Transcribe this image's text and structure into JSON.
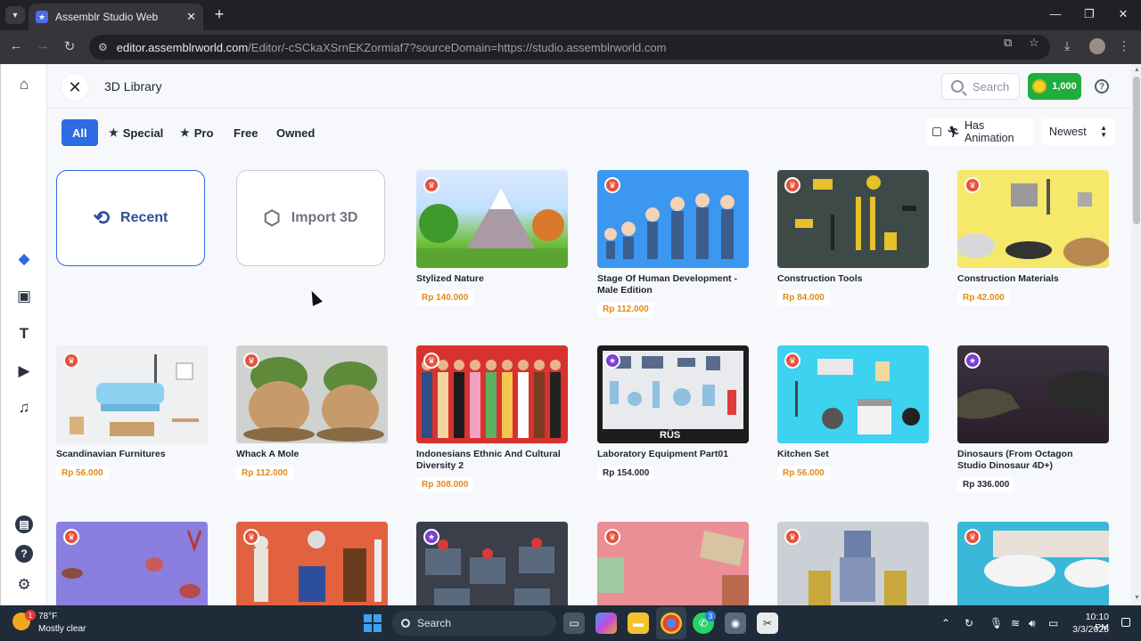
{
  "browser": {
    "tab_title": "Assemblr Studio Web",
    "url_host": "editor.assemblrworld.com",
    "url_rest": "/Editor/-cSCkaXSrnEKZormiaf7?sourceDomain=https://studio.assemblrworld.com"
  },
  "header": {
    "title": "3D Library",
    "search_label": "Search",
    "coins": "1,000"
  },
  "filters": {
    "tabs": [
      {
        "label": "All"
      },
      {
        "label": "Special"
      },
      {
        "label": "Pro"
      },
      {
        "label": "Free"
      },
      {
        "label": "Owned"
      }
    ],
    "has_animation_label": "Has Animation",
    "sort_value": "Newest"
  },
  "actions": {
    "recent_label": "Recent",
    "import_label": "Import 3D"
  },
  "items": [
    {
      "name": "Stylized Nature",
      "price": "Rp 140.000",
      "tier": "pro"
    },
    {
      "name": "Stage Of Human Development - Male Edition",
      "price": "Rp 112.000",
      "tier": "pro"
    },
    {
      "name": "Construction Tools",
      "price": "Rp 84.000",
      "tier": "pro"
    },
    {
      "name": "Construction Materials",
      "price": "Rp 42.000",
      "tier": "pro"
    },
    {
      "name": "Scandinavian Furnitures",
      "price": "Rp 56.000",
      "tier": "pro"
    },
    {
      "name": "Whack A Mole",
      "price": "Rp 112.000",
      "tier": "pro"
    },
    {
      "name": "Indonesians Ethnic And Cultural Diversity 2",
      "price": "Rp 308.000",
      "tier": "pro"
    },
    {
      "name": "Laboratory Equipment Part01",
      "price": "Rp 154.000",
      "tier": "special",
      "thumb_text": "RÜS"
    },
    {
      "name": "Kitchen Set",
      "price": "Rp 56.000",
      "tier": "pro"
    },
    {
      "name": "Dinosaurs (From Octagon Studio Dinosaur 4D+)",
      "price": "Rp 336.000",
      "tier": "special"
    },
    {
      "name": "",
      "price": "",
      "tier": "pro"
    },
    {
      "name": "",
      "price": "",
      "tier": "pro"
    },
    {
      "name": "",
      "price": "",
      "tier": "special"
    },
    {
      "name": "",
      "price": "",
      "tier": "pro"
    },
    {
      "name": "",
      "price": "",
      "tier": "pro"
    },
    {
      "name": "",
      "price": "",
      "tier": "pro"
    }
  ],
  "taskbar": {
    "temp": "78°F",
    "weather": "Mostly clear",
    "weather_badge": "1",
    "search_label": "Search",
    "whatsapp_badge": "3",
    "time": "10:10 PM",
    "date": "3/3/2025"
  },
  "colors": {
    "accent": "#2d6ae3",
    "coin_green": "#1fad3e",
    "price_orange": "#e08a18",
    "pro_badge": "#e8513d",
    "special_badge": "#7c3fd6"
  }
}
